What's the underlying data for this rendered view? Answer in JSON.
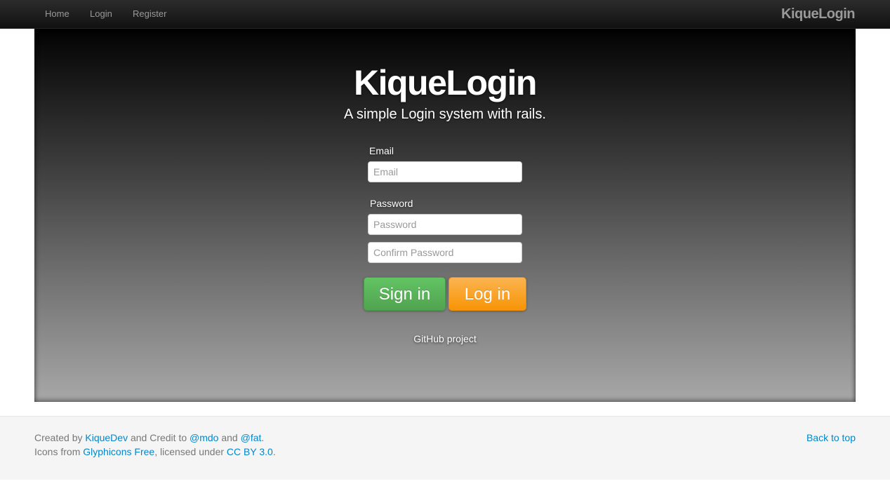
{
  "nav": {
    "items": [
      {
        "label": "Home"
      },
      {
        "label": "Login"
      },
      {
        "label": "Register"
      }
    ],
    "brand": "KiqueLogin"
  },
  "hero": {
    "title": "KiqueLogin",
    "subtitle": "A simple Login system with rails.",
    "form": {
      "email_label": "Email",
      "email_placeholder": "Email",
      "password_label": "Password",
      "password_placeholder": "Password",
      "confirm_placeholder": "Confirm Password",
      "signin_label": "Sign in",
      "login_label": "Log in"
    },
    "github_link": "GitHub project"
  },
  "footer": {
    "line1": {
      "prefix": "Created by ",
      "link1": "KiqueDev",
      "middle": " and Credit to ",
      "link2": "@mdo",
      "and": " and ",
      "link3": "@fat",
      "suffix": "."
    },
    "line2": {
      "prefix": "Icons from ",
      "link1": "Glyphicons Free",
      "middle": ", licensed under ",
      "link2": "CC BY 3.0",
      "suffix": "."
    },
    "back_to_top": "Back to top"
  },
  "colors": {
    "link": "#0088cc",
    "success": "#51a351",
    "warning": "#f89406"
  }
}
